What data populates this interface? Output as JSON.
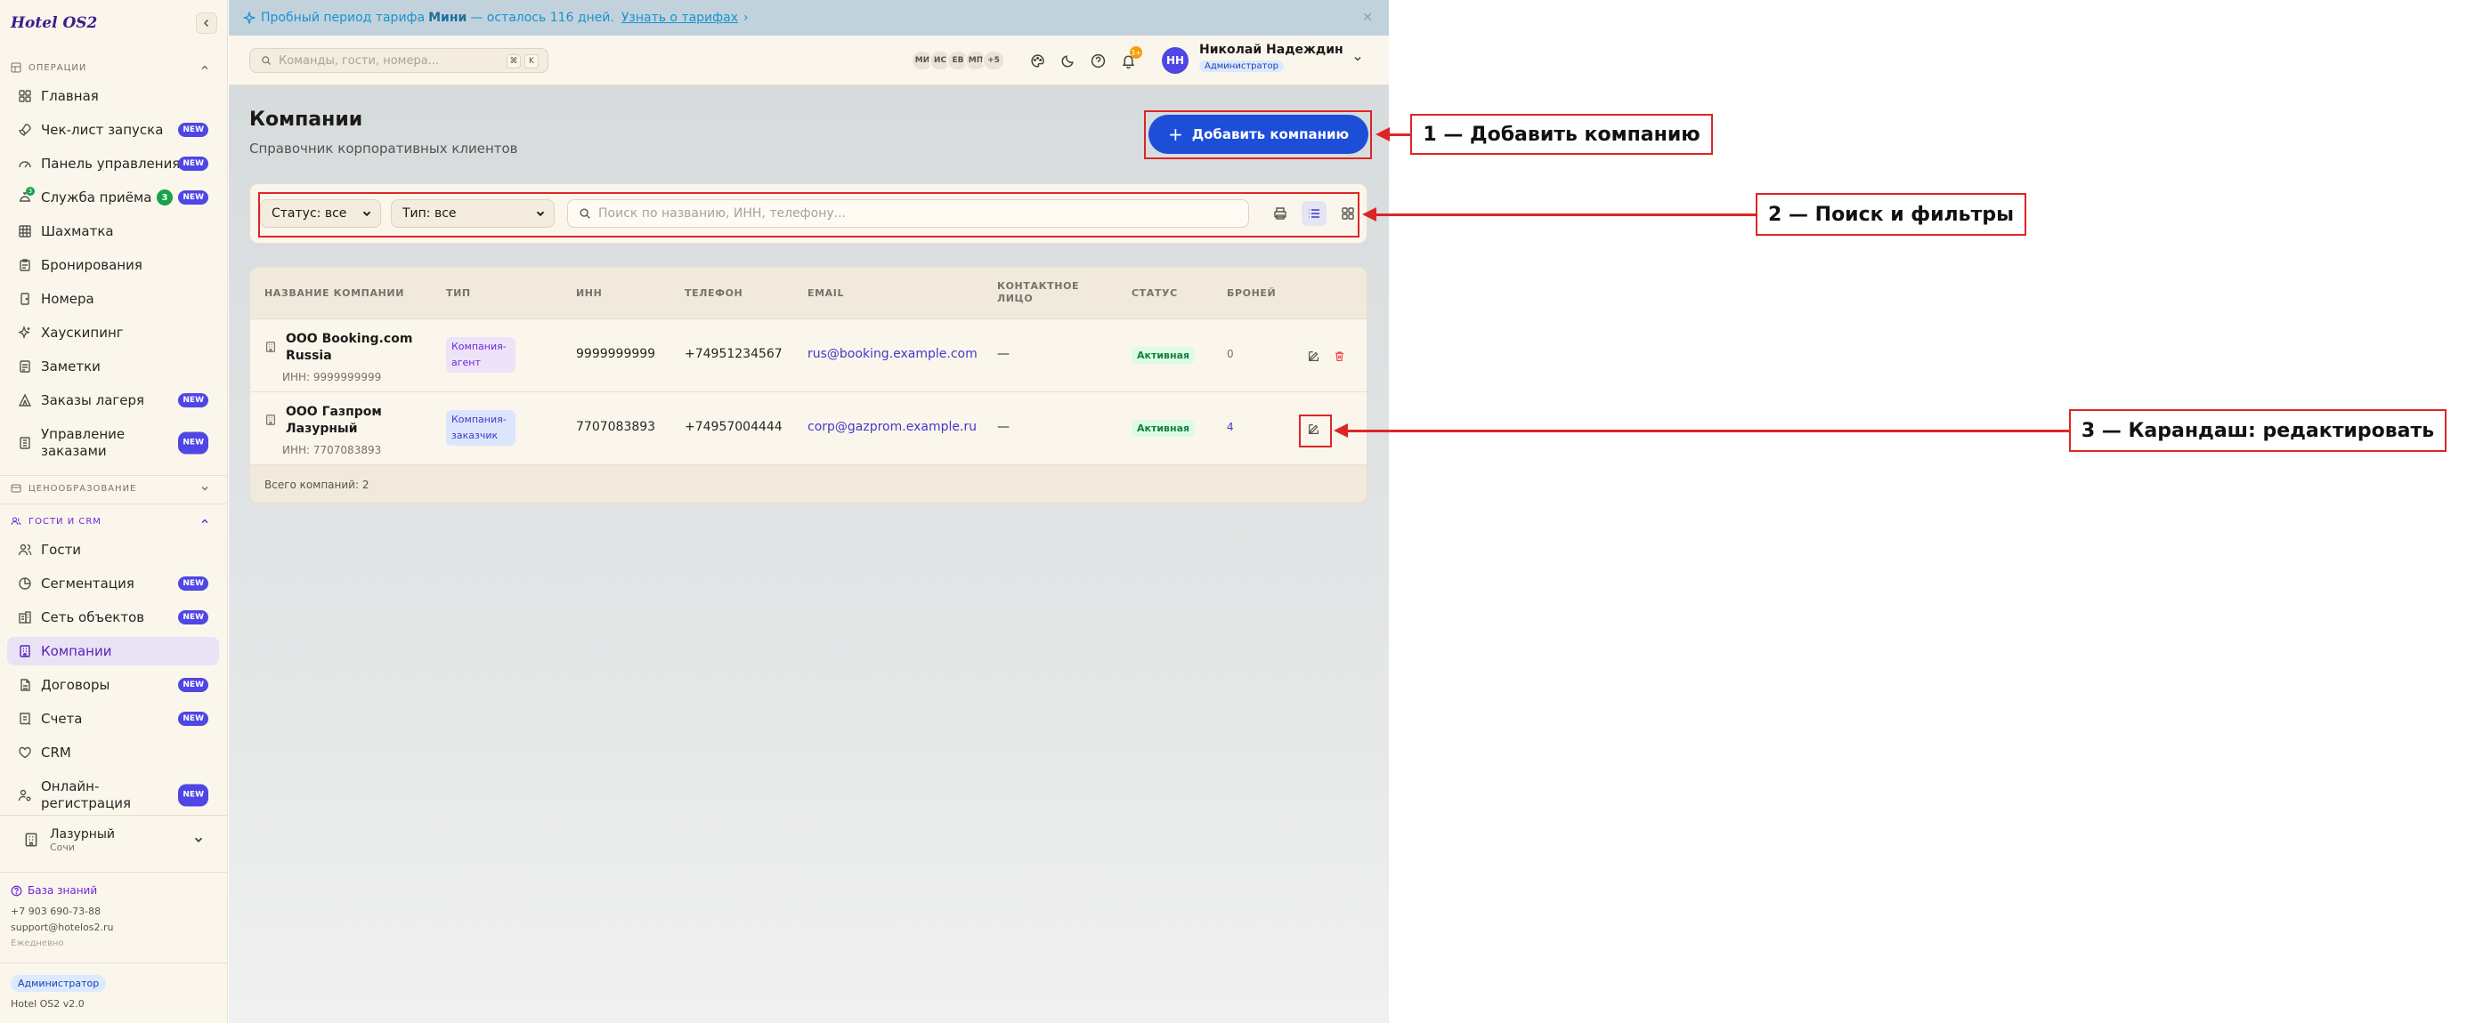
{
  "app": {
    "logo": "Hotel OS2"
  },
  "sidebar": {
    "operations_title": "ОПЕРАЦИИ",
    "pricing_title": "ЦЕНООБРАЗОВАНИЕ",
    "guests_title": "ГОСТИ И CRM",
    "new_badge": "NEW",
    "reception_count": "3",
    "items": [
      {
        "label": "Главная",
        "icon": "grid-icon"
      },
      {
        "label": "Чек-лист запуска",
        "icon": "rocket-icon",
        "new": true
      },
      {
        "label": "Панель управления",
        "icon": "gauge-icon",
        "new": true
      },
      {
        "label": "Служба приёма",
        "icon": "concierge-icon",
        "new": true
      },
      {
        "label": "Шахматка",
        "icon": "table-icon"
      },
      {
        "label": "Бронирования",
        "icon": "clipboard-icon"
      },
      {
        "label": "Номера",
        "icon": "door-icon"
      },
      {
        "label": "Хаускипинг",
        "icon": "sparkles-icon"
      },
      {
        "label": "Заметки",
        "icon": "note-icon"
      },
      {
        "label": "Заказы лагеря",
        "icon": "tent-icon",
        "new": true
      },
      {
        "label": "Управление заказами",
        "icon": "list-icon",
        "new": true
      }
    ],
    "guest_items": [
      {
        "label": "Гости",
        "icon": "users-icon"
      },
      {
        "label": "Сегментация",
        "icon": "pie-icon",
        "new": true
      },
      {
        "label": "Сеть объектов",
        "icon": "building-icon",
        "new": true
      },
      {
        "label": "Компании",
        "icon": "building2-icon",
        "active": true
      },
      {
        "label": "Договоры",
        "icon": "file-icon",
        "new": true
      },
      {
        "label": "Счета",
        "icon": "receipt-icon",
        "new": true
      },
      {
        "label": "CRM",
        "icon": "heart-icon"
      },
      {
        "label": "Онлайн-регистрация",
        "icon": "user-cog-icon",
        "new": true
      }
    ],
    "hotel": {
      "name": "Лазурный",
      "city": "Сочи"
    },
    "knowledge_base": "База знаний",
    "phone": "+7 903 690-73-88",
    "email": "support@hotelos2.ru",
    "schedule": "Ежедневно",
    "role": "Администратор",
    "version": "Hotel OS2 v2.0"
  },
  "banner": {
    "text_before": "Пробный период тарифа",
    "plan": "Мини",
    "text_after": "— осталось 116 дней.",
    "link": "Узнать о тарифах",
    "link_arrow": "›",
    "close": "✕"
  },
  "topbar": {
    "search_placeholder": "Команды, гости, номера...",
    "kbd1": "⌘",
    "kbd2": "K",
    "avatars": [
      "МИ",
      "ИС",
      "ЕВ",
      "МП",
      "+5"
    ],
    "notifications": "3+",
    "user_initials": "НН",
    "user_name": "Николай Надеждин",
    "user_role": "Администратор"
  },
  "page": {
    "title": "Компании",
    "subtitle": "Справочник корпоративных клиентов",
    "add_button": "Добавить компанию",
    "add_plus": "+"
  },
  "filters": {
    "status": "Статус: все",
    "type": "Тип: все",
    "search_placeholder": "Поиск по названию, ИНН, телефону..."
  },
  "table": {
    "headers": {
      "name": "НАЗВАНИЕ КОМПАНИИ",
      "type": "ТИП",
      "inn": "ИНН",
      "phone": "ТЕЛЕФОН",
      "email": "EMAIL",
      "contact1": "КОНТАКТНОЕ",
      "contact2": "ЛИЦО",
      "status": "СТАТУС",
      "bookings": "БРОНЕЙ"
    },
    "rows": [
      {
        "name1": "ООО Booking.com",
        "name2": "Russia",
        "inn_line": "ИНН: 9999999999",
        "type1": "Компания-",
        "type2": "агент",
        "inn": "9999999999",
        "phone": "+74951234567",
        "email": "rus@booking.example.com",
        "contact": "—",
        "status": "Активная",
        "bookings": "0"
      },
      {
        "name1": "ООО Газпром",
        "name2": "Лазурный",
        "inn_line": "ИНН: 7707083893",
        "type1": "Компания-",
        "type2": "заказчик",
        "inn": "7707083893",
        "phone": "+74957004444",
        "email": "corp@gazprom.example.ru",
        "contact": "—",
        "status": "Активная",
        "bookings": "4"
      }
    ],
    "footer": "Всего компаний: 2"
  },
  "annotations": {
    "a1": "1 — Добавить компанию",
    "a2": "2 — Поиск и фильтры",
    "a3": "3 — Карандаш: редактировать",
    "color": "#dc2626"
  },
  "colors": {
    "accent": "#1d4ed8",
    "brand": "#3b1d8f",
    "active_nav": "#5b21b6",
    "new_badge": "#4f46e5"
  }
}
